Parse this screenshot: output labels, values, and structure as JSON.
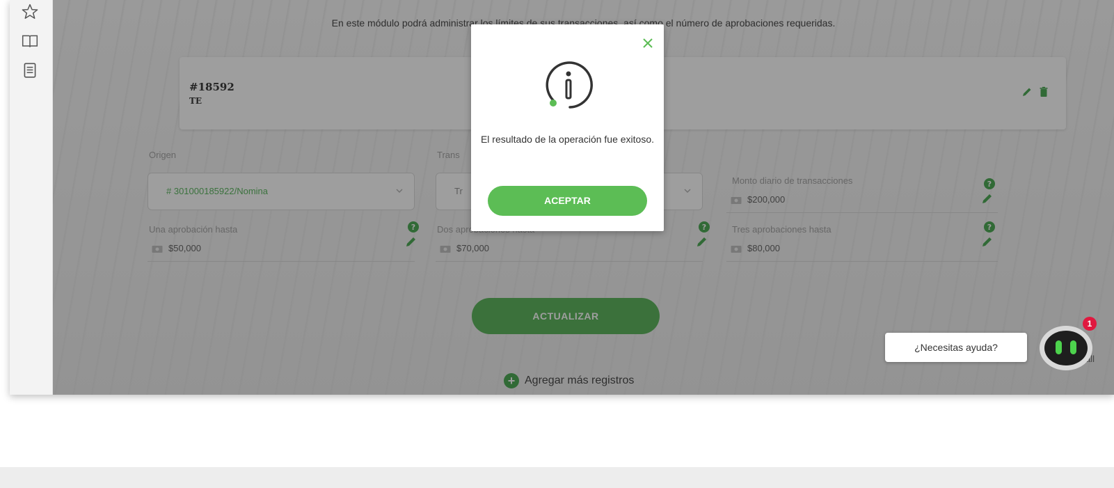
{
  "page": {
    "subtitle": "En este módulo podrá administrar los límites de sus transacciones, así como el número de aprobaciones requeridas."
  },
  "sidebar": {
    "icons": [
      "star-icon",
      "book-icon",
      "document-icon"
    ]
  },
  "record": {
    "id": "#18592",
    "type": "TE"
  },
  "form": {
    "origin_label": "Origen",
    "origin_value": "# 301000185922/Nomina",
    "transaction_label": "Trans",
    "transaction_value": "Tr",
    "daily_label": "Monto diario de transacciones",
    "daily_value": "$200,000",
    "one_label": "Una aprobación hasta",
    "one_value": "$50,000",
    "two_label": "Dos aprobaciones hasta",
    "two_value": "$70,000",
    "three_label": "Tres aprobaciones hasta",
    "three_value": "$80,000",
    "update_label": "ACTUALIZAR",
    "add_more_label": "Agregar más registros"
  },
  "modal": {
    "message": "El resultado de la operación fue exitoso.",
    "accept_label": "ACEPTAR"
  },
  "chat": {
    "bubble_text": "¿Necesitas ayuda?",
    "badge_count": "1",
    "partial_text": "all"
  },
  "colors": {
    "accent_green": "#4cae4c",
    "badge_red": "#e0183f"
  }
}
